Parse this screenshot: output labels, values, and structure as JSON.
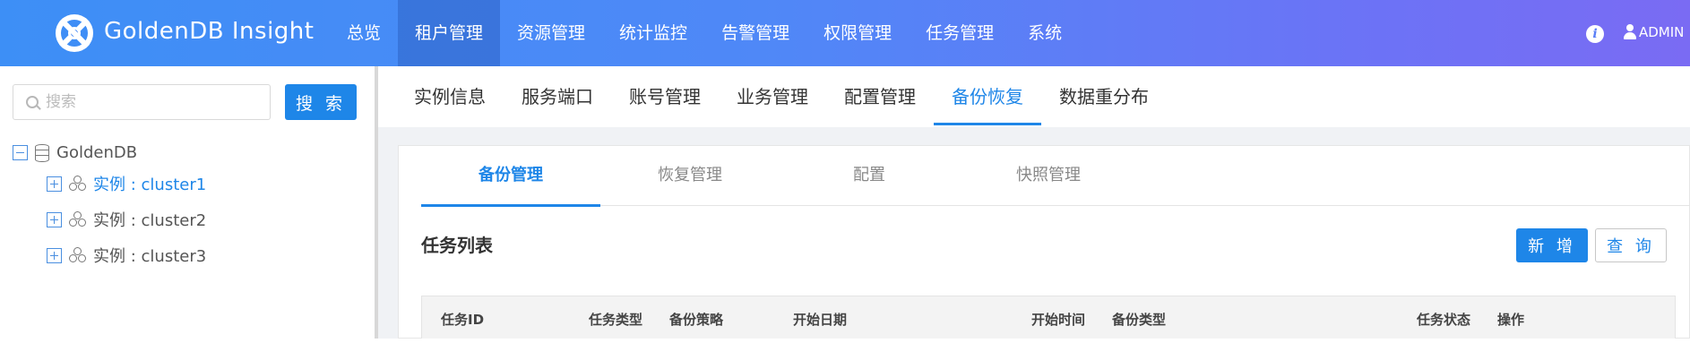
{
  "header": {
    "app_title": "GoldenDB Insight",
    "nav": [
      "总览",
      "租户管理",
      "资源管理",
      "统计监控",
      "告警管理",
      "权限管理",
      "任务管理",
      "系统"
    ],
    "active_nav": "租户管理",
    "info_icon": "i",
    "user": "ADMIN"
  },
  "sidebar": {
    "search_placeholder": "搜索",
    "search_button": "搜 索",
    "tree": {
      "root": "GoldenDB",
      "children": [
        "实例 : cluster1",
        "实例 : cluster2",
        "实例 : cluster3"
      ],
      "selected": "实例 : cluster1"
    }
  },
  "subnav": {
    "items": [
      "实例信息",
      "服务端口",
      "账号管理",
      "业务管理",
      "配置管理",
      "备份恢复",
      "数据重分布"
    ],
    "active": "备份恢复"
  },
  "inner_tabs": {
    "items": [
      "备份管理",
      "恢复管理",
      "配置",
      "快照管理"
    ],
    "active": "备份管理"
  },
  "task_list": {
    "title": "任务列表",
    "add_button": "新 增",
    "query_button": "查 询",
    "columns": [
      "任务ID",
      "任务类型",
      "备份策略",
      "开始日期",
      "开始时间",
      "备份类型",
      "任务状态",
      "操作"
    ]
  },
  "colors": {
    "accent": "#1e86e8",
    "nav_gradient_start": "#3d8ff6",
    "nav_gradient_end": "#7a6bf3"
  }
}
